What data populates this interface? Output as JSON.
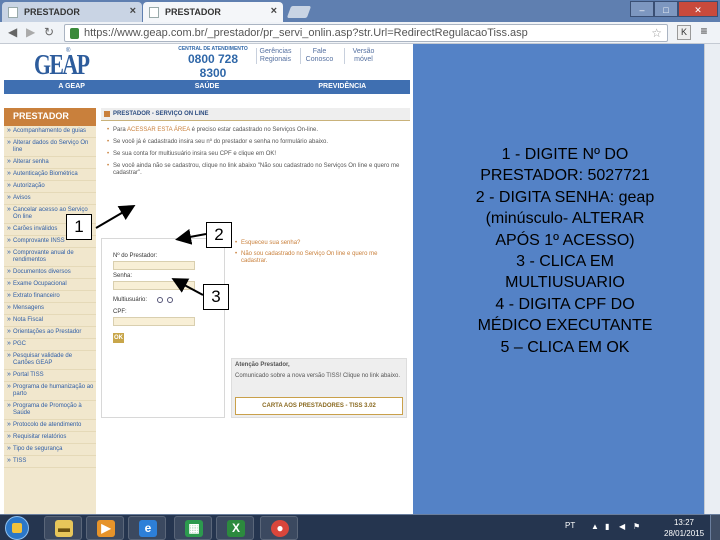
{
  "browser": {
    "tabs": [
      {
        "label": "PRESTADOR"
      },
      {
        "label": "PRESTADOR"
      }
    ],
    "url": "https://www.geap.com.br/_prestador/pr_servi_onlin.asp?str.Url=RedirectRegulacaoTiss.asp",
    "icons": {
      "back": "back-arrow-icon",
      "forward": "forward-arrow-icon",
      "reload": "reload-icon",
      "lock": "lock-icon",
      "star": "star-icon"
    }
  },
  "site": {
    "logo": "GEAP",
    "callcenter": {
      "caption": "CENTRAL DE ATENDIMENTO",
      "number": "0800 728 8300"
    },
    "toplinks": [
      "Gerências Regionais",
      "Fale Conosco",
      "Versão móvel"
    ],
    "nav": [
      "A GEAP",
      "SAÚDE",
      "PREVIDÊNCIA"
    ],
    "sidebar": {
      "title": "PRESTADOR",
      "items": [
        "Acompanhamento de guias",
        "Alterar dados do Serviço On line",
        "Alterar senha",
        "Autenticação Biométrica",
        "Autorização",
        "Avisos",
        "Cancelar acesso ao Serviço On line",
        "Carões inválidos",
        "Comprovante INSS",
        "Comprovante anual de rendimentos",
        "Documentos diversos",
        "Exame Ocupacional",
        "Extrato financeiro",
        "Mensagens",
        "Nota Fiscal",
        "Orientações ao Prestador",
        "PGC",
        "Pesquisar validade de Cartões GEAP",
        "Portal TISS",
        "Programa de humanização ao parto",
        "Programa de Promoção à Saúde",
        "Protocolo de atendimento",
        "Requisitar relatórios",
        "Tipo de segurança",
        "TISS"
      ]
    },
    "content": {
      "title": "PRESTADOR - SERVIÇO ON LINE",
      "bullets": [
        {
          "pre": "Para ",
          "hl": "ACESSAR ESTA ÁREA",
          "post": " é preciso estar cadastrado no Serviços On-line."
        },
        {
          "pre": "Se você já é cadastrado insira seu nº do prestador e senha no formulário abaixo.",
          "hl": "",
          "post": ""
        },
        {
          "pre": "Se sua conta for multiusuário insira seu CPF e clique em OK!",
          "hl": "",
          "post": ""
        },
        {
          "pre": "Se você ainda não se cadastrou, clique no link abaixo \"Não sou cadastrado no Serviços On line e quero me cadastrar\".",
          "hl": "",
          "post": ""
        }
      ],
      "form": {
        "provider_label": "Nº do Prestador:",
        "password_label": "Senha:",
        "multiuser_label": "Multiusuário:",
        "cpf_label": "CPF:",
        "ok_label": "OK"
      },
      "links": [
        "Esqueceu sua senha?",
        "Não sou cadastrado no Serviço On line e quero me cadastrar."
      ],
      "attention": {
        "title": "Atenção Prestador,",
        "body": "Comunicado sobre a nova versão TISS! Clique no link abaixo.",
        "cta": "CARTA AOS PRESTADORES - TISS 3.02"
      }
    }
  },
  "markers": [
    "1",
    "2",
    "3"
  ],
  "instructions": [
    "1 - DIGITE Nº DO",
    "PRESTADOR: 5027721",
    "2 - DIGITA SENHA: geap",
    "(minúsculo- ALTERAR",
    "APÓS 1º ACESSO)",
    "3 - CLICA EM",
    "MULTIUSUARIO",
    "4 - DIGITA CPF DO",
    "MÉDICO EXECUTANTE",
    "5 – CLICA EM OK"
  ],
  "taskbar": {
    "apps": [
      "explorer-icon",
      "media-player-icon",
      "internet-explorer-icon",
      "powerpoint-icon",
      "excel-icon",
      "chrome-icon"
    ],
    "lang": "PT",
    "time": "13:27",
    "date": "28/01/2015"
  },
  "colors": {
    "panel_blue": "#5482c6",
    "geap_blue": "#2d5c9c",
    "accent_orange": "#c9803c"
  }
}
